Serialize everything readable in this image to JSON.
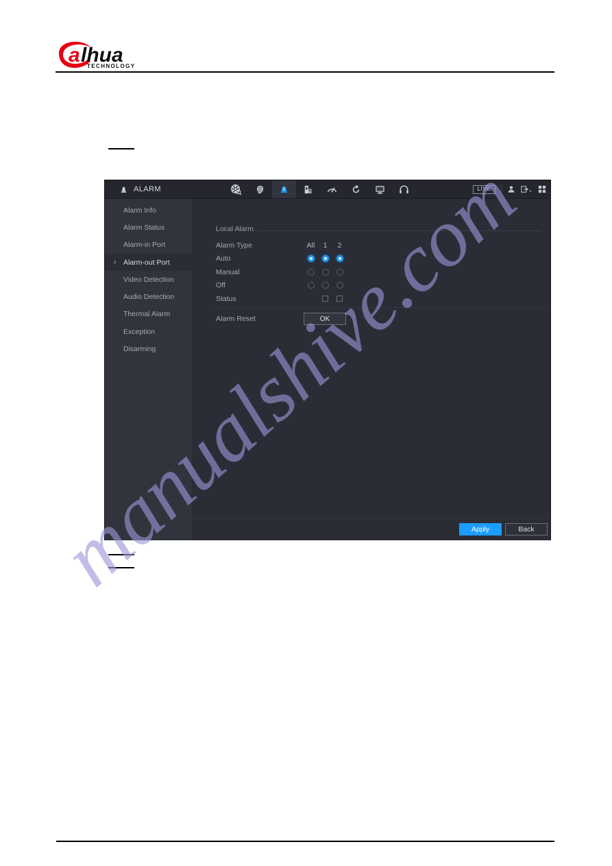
{
  "document": {
    "brand": {
      "name": "alhua",
      "wordmark_a": "a",
      "wordmark_rest": "hua",
      "tagline": "TECHNOLOGY",
      "accent_color": "#E60012",
      "text_color": "#111111"
    },
    "watermark": "manualshive.com",
    "watermark_color": "#9a96d8"
  },
  "nvr": {
    "header": {
      "title": "ALARM",
      "title_icon": "alarm-light-icon",
      "live_badge": "LIVE",
      "tabs": [
        {
          "icon": "search-playback-icon",
          "name": "tab-search",
          "active": false
        },
        {
          "icon": "ai-face-icon",
          "name": "tab-ai",
          "active": false
        },
        {
          "icon": "alarm-light-icon",
          "name": "tab-alarm",
          "active": true
        },
        {
          "icon": "pos-device-icon",
          "name": "tab-pos",
          "active": false
        },
        {
          "icon": "speedometer-icon",
          "name": "tab-network",
          "active": false
        },
        {
          "icon": "refresh-sync-icon",
          "name": "tab-maintenance",
          "active": false
        },
        {
          "icon": "monitor-icon",
          "name": "tab-display",
          "active": false
        },
        {
          "icon": "headset-icon",
          "name": "tab-audio",
          "active": false
        }
      ],
      "right_icons": [
        {
          "icon": "user-account-icon",
          "name": "user-account-button"
        },
        {
          "icon": "logout-icon",
          "name": "logout-button"
        },
        {
          "icon": "apps-grid-icon",
          "name": "apps-grid-button"
        }
      ]
    },
    "sidebar": {
      "items": [
        {
          "label": "Alarm Info",
          "selected": false
        },
        {
          "label": "Alarm Status",
          "selected": false
        },
        {
          "label": "Alarm-in Port",
          "selected": false
        },
        {
          "label": "Alarm-out Port",
          "selected": true
        },
        {
          "label": "Video Detection",
          "selected": false
        },
        {
          "label": "Audio Detection",
          "selected": false
        },
        {
          "label": "Thermal Alarm",
          "selected": false
        },
        {
          "label": "Exception",
          "selected": false
        },
        {
          "label": "Disarming",
          "selected": false
        }
      ],
      "selected_chevron": "›"
    },
    "main": {
      "section_title": "Local Alarm",
      "column_label": "Alarm Type",
      "columns": [
        "All",
        "1",
        "2"
      ],
      "rows": [
        {
          "label": "Auto",
          "type": "radio",
          "states": [
            true,
            true,
            true
          ]
        },
        {
          "label": "Manual",
          "type": "radio",
          "states": [
            false,
            false,
            false
          ]
        },
        {
          "label": "Off",
          "type": "radio",
          "states": [
            false,
            false,
            false
          ]
        },
        {
          "label": "Status",
          "type": "checkbox",
          "states": [
            null,
            false,
            false
          ]
        }
      ],
      "alarm_reset_label": "Alarm Reset",
      "alarm_reset_button": "OK"
    },
    "footer": {
      "apply_label": "Apply",
      "back_label": "Back"
    }
  }
}
